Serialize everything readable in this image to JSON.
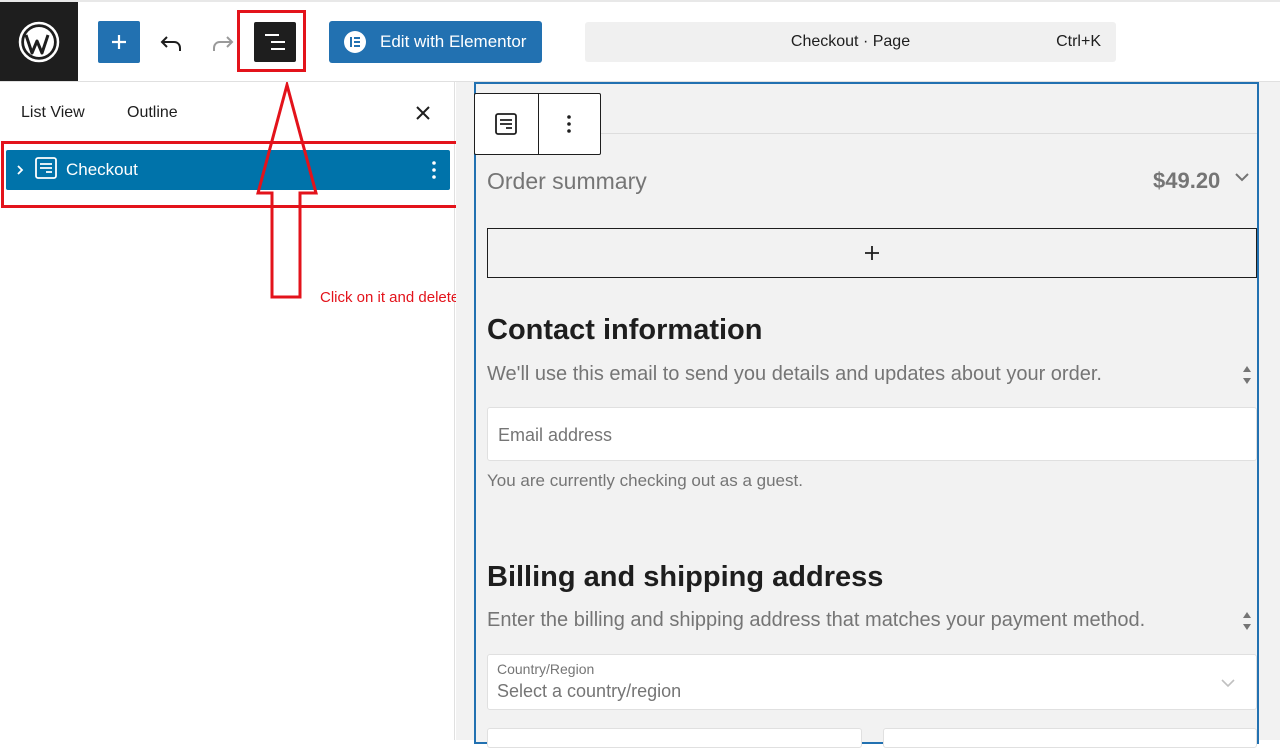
{
  "topbar": {
    "logo_icon": "wordpress-logo-icon",
    "add_icon": "plus-icon",
    "undo_icon": "undo-icon",
    "redo_icon": "redo-icon",
    "listview_icon": "list-view-icon",
    "elementor_label": "Edit with Elementor",
    "command_title": "Checkout · Page",
    "command_shortcut": "Ctrl+K"
  },
  "sidebar": {
    "tabs": [
      "List View",
      "Outline"
    ],
    "close_icon": "close-icon",
    "items": [
      {
        "label": "Checkout",
        "icon": "checkout-block-icon"
      }
    ]
  },
  "annotation": {
    "text": "Click on it and delete it",
    "color": "#e3131b"
  },
  "canvas": {
    "order_summary_label": "Order summary",
    "order_total": "$49.20",
    "contact_heading": "Contact information",
    "contact_description": "We'll use this email to send you details and updates about your order.",
    "email_placeholder": "Email address",
    "guest_note": "You are currently checking out as a guest.",
    "billing_heading": "Billing and shipping address",
    "billing_description": "Enter the billing and shipping address that matches your payment method.",
    "country_label": "Country/Region",
    "country_placeholder": "Select a country/region"
  },
  "colors": {
    "accent": "#2271b1",
    "selected_row": "#0073aa",
    "highlight": "#e3131b",
    "dark": "#1e1e1e"
  }
}
